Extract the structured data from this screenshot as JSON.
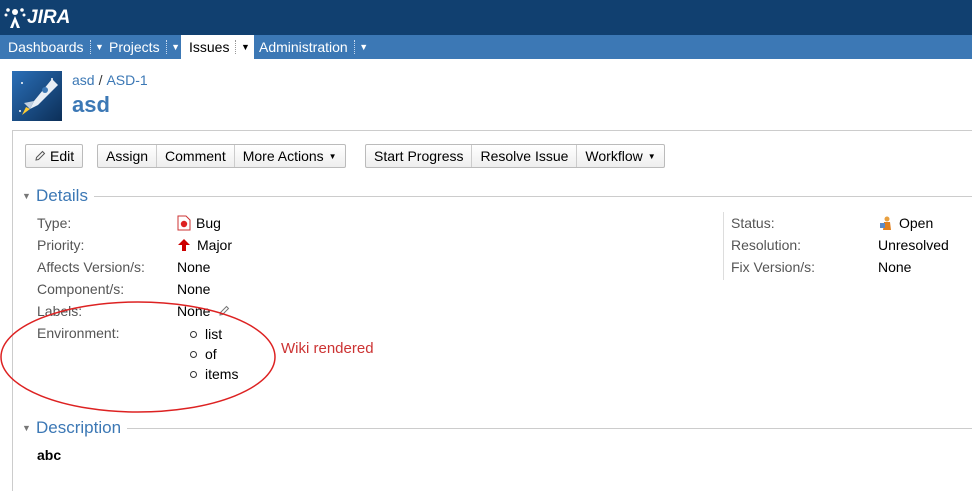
{
  "header": {
    "logo_text": "JIRA"
  },
  "nav": [
    {
      "label": "Dashboards"
    },
    {
      "label": "Projects"
    },
    {
      "label": "Issues"
    },
    {
      "label": "Administration"
    }
  ],
  "breadcrumb": {
    "project": "asd",
    "separator": "/",
    "issue_key": "ASD-1"
  },
  "issue": {
    "summary": "asd"
  },
  "toolbar": {
    "edit": "Edit",
    "assign": "Assign",
    "comment": "Comment",
    "more_actions": "More Actions",
    "start_progress": "Start Progress",
    "resolve_issue": "Resolve Issue",
    "workflow": "Workflow"
  },
  "details": {
    "heading": "Details",
    "type_label": "Type:",
    "type_value": "Bug",
    "priority_label": "Priority:",
    "priority_value": "Major",
    "affects_label": "Affects Version/s:",
    "affects_value": "None",
    "component_label": "Component/s:",
    "component_value": "None",
    "labels_label": "Labels:",
    "labels_value": "None",
    "environment_label": "Environment:",
    "environment_items": [
      "list",
      "of",
      "items"
    ],
    "status_label": "Status:",
    "status_value": "Open",
    "resolution_label": "Resolution:",
    "resolution_value": "Unresolved",
    "fix_label": "Fix Version/s:",
    "fix_value": "None"
  },
  "annotation": {
    "text": "Wiki rendered",
    "color": "#cc3333"
  },
  "description": {
    "heading": "Description",
    "text": "abc"
  },
  "colors": {
    "topbar": "#114070",
    "navbar": "#3c78b5",
    "link": "#3c78b5"
  }
}
